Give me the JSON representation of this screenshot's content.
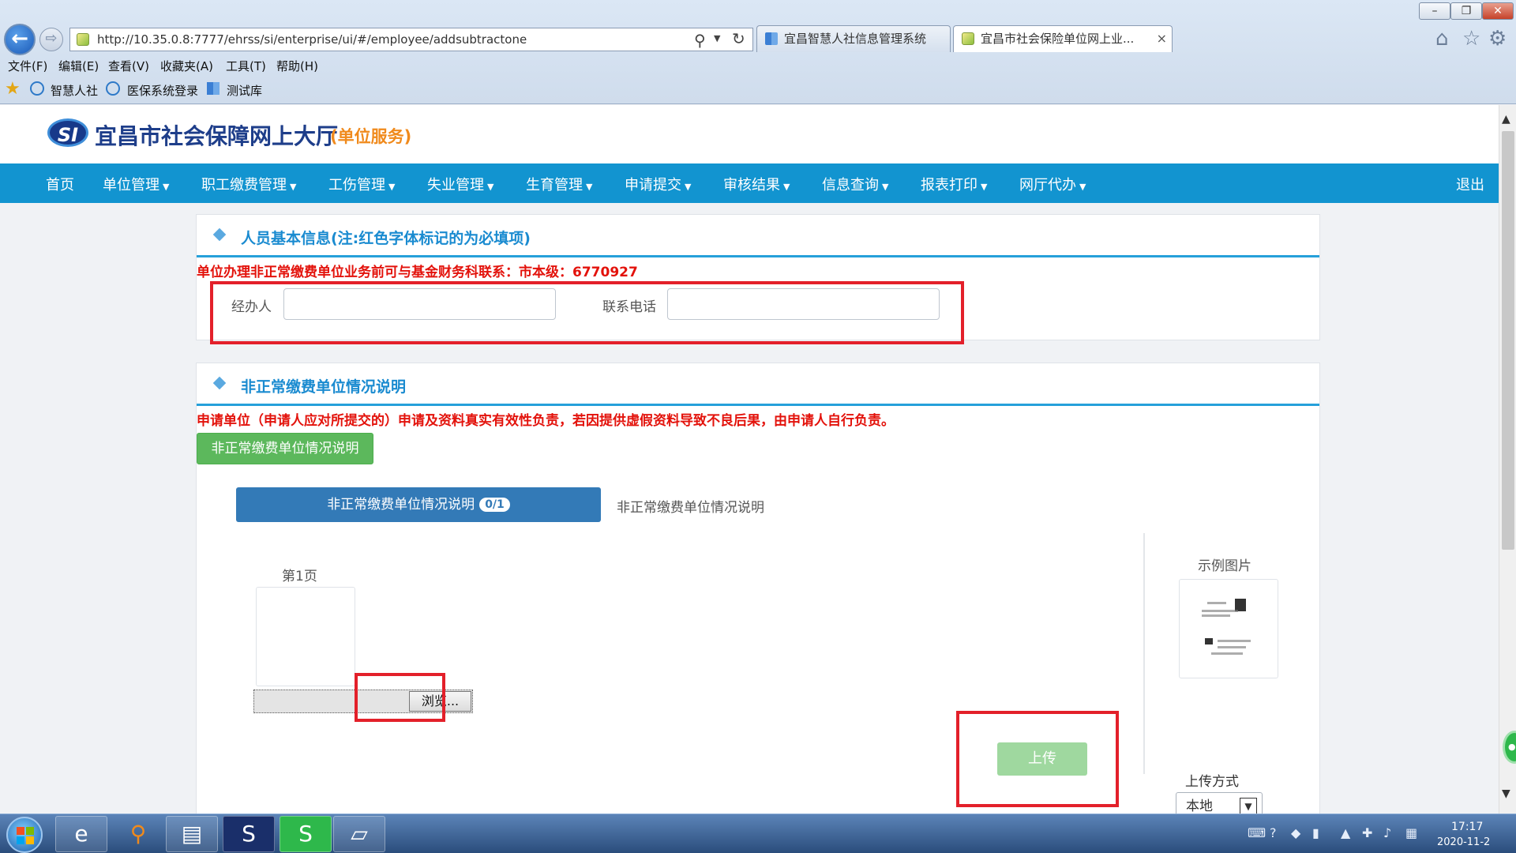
{
  "browser": {
    "address_url": "http://10.35.0.8:7777/ehrss/si/enterprise/ui/#/employee/addsubtractone",
    "tabs": [
      {
        "label": "宜昌智慧人社信息管理系统"
      },
      {
        "label": "宜昌市社会保险单位网上业..."
      }
    ],
    "tab_close": "×",
    "menu": [
      "文件(F)",
      "编辑(E)",
      "查看(V)",
      "收藏夹(A)",
      "工具(T)",
      "帮助(H)"
    ],
    "favorites": [
      "智慧人社",
      "医保系统登录",
      "测试库"
    ]
  },
  "site": {
    "logo_text": "SI",
    "title": "宜昌市社会保障网上大厅",
    "subtitle": "(单位服务)"
  },
  "nav": {
    "items": [
      "首页",
      "单位管理",
      "职工缴费管理",
      "工伤管理",
      "失业管理",
      "生育管理",
      "申请提交",
      "审核结果",
      "信息查询",
      "报表打印",
      "网厅代办"
    ],
    "logout": "退出"
  },
  "basic_info": {
    "title": "人员基本信息(注:红色字体标记的为必填项)",
    "note": "单位办理非正常缴费单位业务前可与基金财务科联系：市本级：6770927",
    "operator_label": "经办人",
    "operator_value": "",
    "phone_label": "联系电话",
    "phone_value": ""
  },
  "desc_section": {
    "title": "非正常缴费单位情况说明",
    "note": "申请单位（申请人应对所提交的）申请及资料真实有效性负责，若因提供虚假资料导致不良后果，由申请人自行负责。",
    "green_button": "非正常缴费单位情况说明",
    "tab_active_label": "非正常缴费单位情况说明",
    "tab_active_badge": "0/1",
    "tab_inactive_label": "非正常缴费单位情况说明",
    "page_label": "第1页",
    "browse_button": "浏览...",
    "sample_label": "示例图片",
    "upload_button": "上传",
    "upload_mode_label": "上传方式",
    "upload_mode_value": "本地"
  },
  "taskbar": {
    "time": "17:17",
    "date": "2020-11-2"
  },
  "colors": {
    "nav_blue": "#1294d0",
    "title_blue": "#1a8bd0",
    "required_red": "#e3120b",
    "primary_tab": "#337ab7",
    "success_green": "#5cb85c",
    "highlight_box": "#e3202a"
  }
}
